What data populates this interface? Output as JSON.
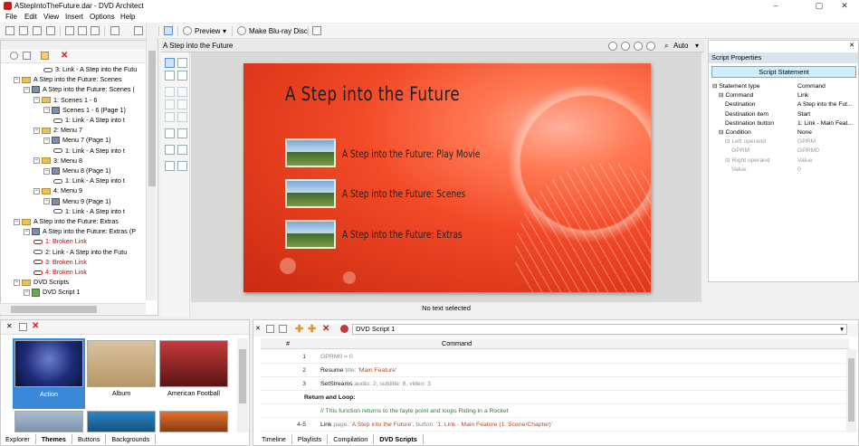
{
  "window": {
    "title": "AStepIntoTheFuture.dar - DVD Architect",
    "controls": [
      "–",
      "▢",
      "✕"
    ]
  },
  "menubar": [
    "File",
    "Edit",
    "View",
    "Insert",
    "Options",
    "Help"
  ],
  "toolbar": {
    "preview_label": "Preview",
    "make_disc_label": "Make Blu-ray Disc"
  },
  "explorer": {
    "tree": [
      {
        "text": "3: Link - A Step into the Futu",
        "type": "link",
        "indent": 4
      },
      {
        "text": "A Step into the Future: Scenes",
        "type": "folder",
        "indent": 1
      },
      {
        "text": "A Step into the Future: Scenes (",
        "type": "menu",
        "indent": 2
      },
      {
        "text": "1: Scenes 1 - 6",
        "type": "folder",
        "indent": 3
      },
      {
        "text": "Scenes 1 - 6 (Page 1)",
        "type": "menu",
        "indent": 4
      },
      {
        "text": "1: Link - A Step into t",
        "type": "link",
        "indent": 5
      },
      {
        "text": "2: Menu 7",
        "type": "folder",
        "indent": 3
      },
      {
        "text": "Menu 7 (Page 1)",
        "type": "menu",
        "indent": 4
      },
      {
        "text": "1: Link - A Step into t",
        "type": "link",
        "indent": 5
      },
      {
        "text": "3: Menu 8",
        "type": "folder",
        "indent": 3
      },
      {
        "text": "Menu 8 (Page 1)",
        "type": "menu",
        "indent": 4
      },
      {
        "text": "1: Link - A Step into t",
        "type": "link",
        "indent": 5
      },
      {
        "text": "4: Menu 9",
        "type": "folder",
        "indent": 3
      },
      {
        "text": "Menu 9 (Page 1)",
        "type": "menu",
        "indent": 4
      },
      {
        "text": "1: Link - A Step into t",
        "type": "link",
        "indent": 5
      },
      {
        "text": "A Step into the Future: Extras",
        "type": "folder",
        "indent": 1
      },
      {
        "text": "A Step into the Future: Extras (P",
        "type": "menu",
        "indent": 2
      },
      {
        "text": "1: Broken Link",
        "type": "broken",
        "indent": 3
      },
      {
        "text": "2: Link - A Step into the Futu",
        "type": "link",
        "indent": 3
      },
      {
        "text": "3: Broken Link",
        "type": "broken",
        "indent": 3
      },
      {
        "text": "4: Broken Link",
        "type": "broken",
        "indent": 3
      },
      {
        "text": "DVD Scripts",
        "type": "folder",
        "indent": 1
      },
      {
        "text": "DVD Script 1",
        "type": "script",
        "indent": 2
      }
    ]
  },
  "editor": {
    "tab_label": "A Step into the Future",
    "zoom_label": "Auto",
    "menu_title": "A Step into the Future",
    "buttons": [
      "A Step into the Future: Play Movie",
      "A Step into the Future: Scenes",
      "A Step into the Future: Extras"
    ],
    "status": "No text selected"
  },
  "properties": {
    "header": "Script Properties",
    "statement_button": "Script Statement",
    "rows": [
      {
        "key": "Statement type",
        "value": "Command",
        "indent": 0,
        "dim": false,
        "exp": "⊟"
      },
      {
        "key": "Command",
        "value": "Link",
        "indent": 1,
        "dim": false,
        "exp": "⊟"
      },
      {
        "key": "Destination",
        "value": "A Step into the Fut...",
        "indent": 2,
        "dim": false,
        "exp": ""
      },
      {
        "key": "Destination item",
        "value": "Start",
        "indent": 2,
        "dim": false,
        "exp": ""
      },
      {
        "key": "Destination button",
        "value": "1: Link - Main Feat...",
        "indent": 2,
        "dim": false,
        "exp": ""
      },
      {
        "key": "Condition",
        "value": "None",
        "indent": 1,
        "dim": false,
        "exp": "⊟"
      },
      {
        "key": "Left operand",
        "value": "GPRM",
        "indent": 2,
        "dim": true,
        "exp": "⊟"
      },
      {
        "key": "GPRM",
        "value": "GPRM0",
        "indent": 3,
        "dim": true,
        "exp": ""
      },
      {
        "key": "Right operand",
        "value": "Value",
        "indent": 2,
        "dim": true,
        "exp": "⊟"
      },
      {
        "key": "Value",
        "value": "0",
        "indent": 3,
        "dim": true,
        "exp": ""
      }
    ]
  },
  "themes": {
    "tiles": [
      {
        "name": "Action",
        "selected": true
      },
      {
        "name": "Album",
        "selected": false
      },
      {
        "name": "American Football",
        "selected": false
      }
    ],
    "tabs": [
      "Explorer",
      "Themes",
      "Buttons",
      "Backgrounds"
    ],
    "active_tab": "Themes"
  },
  "script": {
    "dropdown": "DVD Script 1",
    "columns": [
      "#",
      "Command"
    ],
    "rows": [
      {
        "num": "1",
        "parts": [
          [
            "arg",
            "GPRM0  = 0"
          ]
        ]
      },
      {
        "num": "2",
        "parts": [
          [
            "kw",
            "Resume "
          ],
          [
            "arg",
            "title: "
          ],
          [
            "str",
            "'Main Feature'"
          ]
        ]
      },
      {
        "num": "3",
        "parts": [
          [
            "kw",
            "SetStreams "
          ],
          [
            "arg",
            "audio: 2, subtitle: 8, video: 3"
          ]
        ]
      },
      {
        "num": "",
        "parts": [
          [
            "kw",
            "Return and Loop:"
          ]
        ],
        "bold": true
      },
      {
        "num": "",
        "parts": [
          [
            "cmt",
            "// This function returns to the fayte point and loops Riding in a Rocket"
          ]
        ]
      },
      {
        "num": "4-5",
        "parts": [
          [
            "kw",
            "Link "
          ],
          [
            "arg",
            "page: "
          ],
          [
            "str",
            "'A Step into the Future'"
          ],
          [
            "arg",
            ", button: "
          ],
          [
            "str",
            "'1: Link - Main Feature (1: Scene/Chapter)'"
          ]
        ]
      }
    ],
    "tabs": [
      "Timeline",
      "Playlists",
      "Compilation",
      "DVD Scripts"
    ],
    "active_tab": "DVD Scripts"
  }
}
